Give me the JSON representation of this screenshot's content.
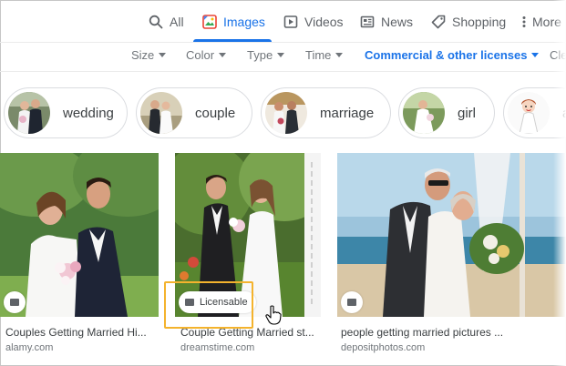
{
  "tabs": [
    {
      "label": "All",
      "icon": "search-icon"
    },
    {
      "label": "Images",
      "icon": "images-icon",
      "active": true
    },
    {
      "label": "Videos",
      "icon": "play-icon"
    },
    {
      "label": "News",
      "icon": "news-icon"
    },
    {
      "label": "Shopping",
      "icon": "tag-icon"
    },
    {
      "label": "More",
      "icon": "more-vert-icon"
    }
  ],
  "filters": [
    {
      "label": "Size"
    },
    {
      "label": "Color"
    },
    {
      "label": "Type"
    },
    {
      "label": "Time"
    },
    {
      "label": "Commercial & other licenses",
      "active": true
    },
    {
      "label": "Cle"
    }
  ],
  "chips": [
    {
      "label": "wedding"
    },
    {
      "label": "couple"
    },
    {
      "label": "marriage"
    },
    {
      "label": "girl"
    },
    {
      "label": "a"
    }
  ],
  "results": [
    {
      "caption": "Couples Getting Married Hi...",
      "source": "alamy.com"
    },
    {
      "caption": "Couple Getting Married st...",
      "source": "dreamstime.com",
      "badge": "Licensable"
    },
    {
      "caption": "people getting married pictures ...",
      "source": "depositphotos.com"
    }
  ],
  "colors": {
    "accent": "#1a73e8",
    "highlight": "#f4b32d",
    "muted": "#70757a"
  }
}
